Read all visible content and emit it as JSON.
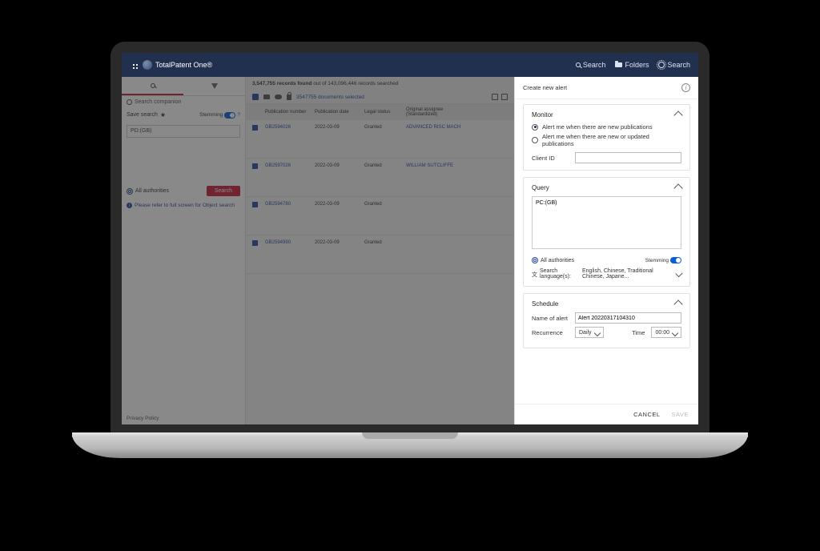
{
  "header": {
    "brand": "TotalPatent One®",
    "search": "Search",
    "folders": "Folders",
    "searchHist": "Search"
  },
  "left": {
    "searchCompanion": "Search companion",
    "saveSearch": "Save search",
    "stemming": "Stemming",
    "query": "PD:(GB)",
    "allAuthorities": "All authorities",
    "searchBtn": "Search",
    "fullScreenNote": "Please refer to full screen for Object search",
    "privacy": "Privacy Policy"
  },
  "results": {
    "countText": "3,547,755 records found",
    "countSuffix": " out of 143,096,446 records searched",
    "selectedText": "3547755 documents selected",
    "columns": {
      "pubNum": "Publication number",
      "pubDate": "Publication date",
      "legal": "Legal status",
      "assignee": "Original assignee (Standardized)"
    },
    "rows": [
      {
        "pn": "GB2594026",
        "pd": "2022-03-09",
        "ls": "Granted",
        "oa": "ADVANCED RISC MACH"
      },
      {
        "pn": "GB2597026",
        "pd": "2022-03-09",
        "ls": "Granted",
        "oa": "WILLIAM SUTCLIFFE"
      },
      {
        "pn": "GB2594780",
        "pd": "2022-03-09",
        "ls": "Granted",
        "oa": ""
      },
      {
        "pn": "GB2594990",
        "pd": "2022-03-09",
        "ls": "Granted",
        "oa": ""
      }
    ]
  },
  "panel": {
    "title": "Create new alert",
    "monitor": {
      "heading": "Monitor",
      "opt1": "Alert me when there are new publications",
      "opt2": "Alert me when there are new or updated publications",
      "clientId": "Client ID"
    },
    "query": {
      "heading": "Query",
      "value": "PC:(GB)",
      "allAuth": "All authorities",
      "stemming": "Stemming",
      "langLabel": "Search language(s):",
      "langValue": "English, Chinese, Traditional Chinese, Japane..."
    },
    "schedule": {
      "heading": "Schedule",
      "nameLabel": "Name of alert",
      "nameValue": "Alert 20220317104310",
      "recurrence": "Recurrence",
      "recurrenceValue": "Daily",
      "timeLabel": "Time",
      "timeValue": "00:00"
    },
    "cancel": "CANCEL",
    "save": "SAVE"
  }
}
